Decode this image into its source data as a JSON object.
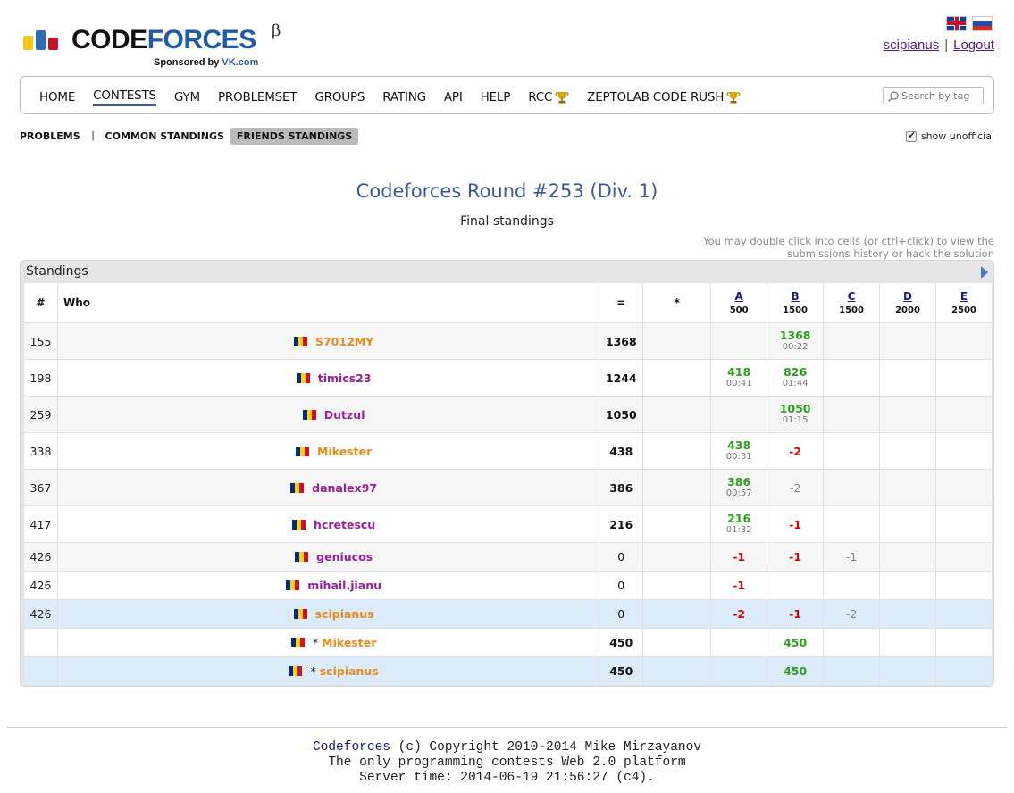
{
  "header": {
    "logo_word1": "CODE",
    "logo_word2": "FORCES",
    "logo_beta": "β",
    "sponsor_prefix": "Sponsored by",
    "sponsor_name": "VK.com",
    "username": "scipianus",
    "separator": "|",
    "logout": "Logout"
  },
  "menu": {
    "items": [
      "HOME",
      "CONTESTS",
      "GYM",
      "PROBLEMSET",
      "GROUPS",
      "RATING",
      "API",
      "HELP",
      "RCC",
      "ZEPTOLAB CODE RUSH"
    ],
    "search_placeholder": "Search by tag"
  },
  "subnav": {
    "problems": "PROBLEMS",
    "separator": "|",
    "common": "COMMON STANDINGS",
    "friends": "FRIENDS STANDINGS",
    "show_unofficial": "show unofficial"
  },
  "contest": {
    "title": "Codeforces Round #253 (Div. 1)",
    "subtitle": "Final standings",
    "hint_line1": "You may double click into cells (or ctrl+click) to view the",
    "hint_line2": "submissions history or hack the solution"
  },
  "standings": {
    "panel_title": "Standings",
    "headers": {
      "rank": "#",
      "who": "Who",
      "points": "=",
      "penalty": "*"
    },
    "problems": [
      {
        "letter": "A",
        "points": "500"
      },
      {
        "letter": "B",
        "points": "1500"
      },
      {
        "letter": "C",
        "points": "1500"
      },
      {
        "letter": "D",
        "points": "2000"
      },
      {
        "letter": "E",
        "points": "2500"
      }
    ],
    "rows": [
      {
        "rank": "155",
        "star": "",
        "handle": "S7012MY",
        "score": "1368",
        "cells": [
          {
            "v": "",
            "t": ""
          },
          {
            "v": "1368",
            "t": "00:22"
          },
          {
            "v": "",
            "t": ""
          },
          {
            "v": "",
            "t": ""
          },
          {
            "v": "",
            "t": ""
          }
        ]
      },
      {
        "rank": "198",
        "star": "",
        "handle": "timics23",
        "score": "1244",
        "cells": [
          {
            "v": "418",
            "t": "00:41"
          },
          {
            "v": "826",
            "t": "01:44"
          },
          {
            "v": "",
            "t": ""
          },
          {
            "v": "",
            "t": ""
          },
          {
            "v": "",
            "t": ""
          }
        ]
      },
      {
        "rank": "259",
        "star": "",
        "handle": "Dutzul",
        "score": "1050",
        "cells": [
          {
            "v": "",
            "t": ""
          },
          {
            "v": "1050",
            "t": "01:15"
          },
          {
            "v": "",
            "t": ""
          },
          {
            "v": "",
            "t": ""
          },
          {
            "v": "",
            "t": ""
          }
        ]
      },
      {
        "rank": "338",
        "star": "",
        "handle": "Mikester",
        "score": "438",
        "cells": [
          {
            "v": "438",
            "t": "00:31"
          },
          {
            "v": "-2",
            "t": ""
          },
          {
            "v": "",
            "t": ""
          },
          {
            "v": "",
            "t": ""
          },
          {
            "v": "",
            "t": ""
          }
        ]
      },
      {
        "rank": "367",
        "star": "",
        "handle": "danalex97",
        "score": "386",
        "cells": [
          {
            "v": "386",
            "t": "00:57"
          },
          {
            "v": "-2",
            "t": ""
          },
          {
            "v": "",
            "t": ""
          },
          {
            "v": "",
            "t": ""
          },
          {
            "v": "",
            "t": ""
          }
        ]
      },
      {
        "rank": "417",
        "star": "",
        "handle": "hcretescu",
        "score": "216",
        "cells": [
          {
            "v": "216",
            "t": "01:32"
          },
          {
            "v": "-1",
            "t": ""
          },
          {
            "v": "",
            "t": ""
          },
          {
            "v": "",
            "t": ""
          },
          {
            "v": "",
            "t": ""
          }
        ]
      },
      {
        "rank": "426",
        "star": "",
        "handle": "geniucos",
        "score": "0",
        "cells": [
          {
            "v": "-1",
            "t": ""
          },
          {
            "v": "-1",
            "t": ""
          },
          {
            "v": "-1",
            "t": ""
          },
          {
            "v": "",
            "t": ""
          },
          {
            "v": "",
            "t": ""
          }
        ]
      },
      {
        "rank": "426",
        "star": "",
        "handle": "mihail.jianu",
        "score": "0",
        "cells": [
          {
            "v": "-1",
            "t": ""
          },
          {
            "v": "",
            "t": ""
          },
          {
            "v": "",
            "t": ""
          },
          {
            "v": "",
            "t": ""
          },
          {
            "v": "",
            "t": ""
          }
        ]
      },
      {
        "rank": "426",
        "star": "",
        "handle": "scipianus",
        "score": "0",
        "cells": [
          {
            "v": "-2",
            "t": ""
          },
          {
            "v": "-1",
            "t": ""
          },
          {
            "v": "-2",
            "t": ""
          },
          {
            "v": "",
            "t": ""
          },
          {
            "v": "",
            "t": ""
          }
        ]
      },
      {
        "rank": "",
        "star": "*",
        "handle": "Mikester",
        "score": "450",
        "cells": [
          {
            "v": "",
            "t": ""
          },
          {
            "v": "450",
            "t": ""
          },
          {
            "v": "",
            "t": ""
          },
          {
            "v": "",
            "t": ""
          },
          {
            "v": "",
            "t": ""
          }
        ]
      },
      {
        "rank": "",
        "star": "*",
        "handle": "scipianus",
        "score": "450",
        "cells": [
          {
            "v": "",
            "t": ""
          },
          {
            "v": "450",
            "t": ""
          },
          {
            "v": "",
            "t": ""
          },
          {
            "v": "",
            "t": ""
          },
          {
            "v": "",
            "t": ""
          }
        ]
      }
    ]
  },
  "footer": {
    "link": "Codeforces",
    "copyright": " (c) Copyright 2010-2014 Mike Mirzayanov",
    "line2": "The only programming contests Web 2.0 platform",
    "line3": "Server time: 2014-06-19 21:56:27 (c4)."
  },
  "colors": {
    "accent": "#3b5998",
    "accepted": "#2ca01c",
    "rejected": "#dd0000",
    "handle_orange": "#e98b1e",
    "handle_violet": "#9a1f9a",
    "highlight_row": "#dcebf9"
  }
}
